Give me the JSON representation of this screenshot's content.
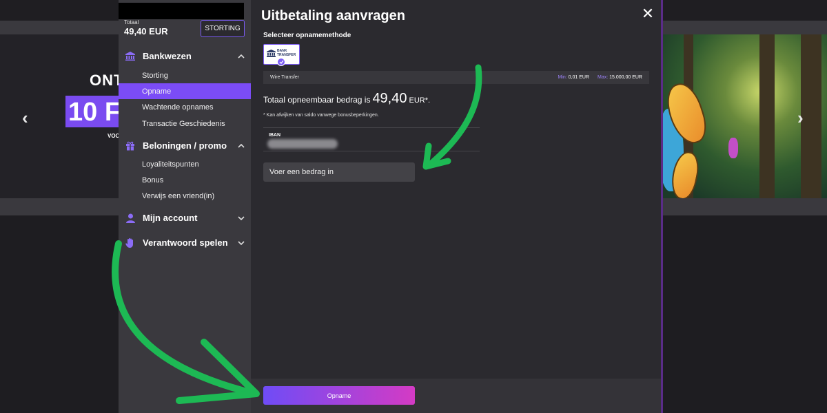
{
  "background": {
    "hero_title": "ONT",
    "hero_badge": "10 F",
    "hero_sub": "VOO",
    "prev_arrow": "‹",
    "next_arrow": "›"
  },
  "sidebar": {
    "total_label": "Totaal",
    "total_value": "49,40 EUR",
    "deposit_button": "STORTING",
    "sections": [
      {
        "label": "Bankwezen",
        "icon": "bank-icon",
        "chevron": "chevron-up-icon",
        "items": [
          "Storting",
          "Opname",
          "Wachtende opnames",
          "Transactie Geschiedenis"
        ],
        "active_item": "Opname"
      },
      {
        "label": "Beloningen / promo",
        "icon": "gift-icon",
        "chevron": "chevron-up-icon",
        "items": [
          "Loyaliteitspunten",
          "Bonus",
          "Verwijs een vriend(in)"
        ]
      },
      {
        "label": "Mijn account",
        "icon": "user-icon",
        "chevron": "chevron-down-icon"
      },
      {
        "label": "Verantwoord spelen",
        "icon": "hand-icon",
        "chevron": "chevron-down-icon"
      }
    ]
  },
  "modal": {
    "title": "Uitbetaling aanvragen",
    "close": "✕",
    "method_label": "Selecteer opnamemethode",
    "bank_card_text": "BANK TRANSFER",
    "method_name": "Wire Transfer",
    "min_label": "Min:",
    "min_value": "0,01 EUR",
    "max_label": "Max:",
    "max_value": "15.000,00 EUR",
    "total_prefix": "Totaal opneembaar bedrag is",
    "total_amount": "49,40",
    "total_suffix": "EUR*.",
    "note": "* Kan afwijken van saldo vanwege bonusbeperkingen.",
    "iban_label": "IBAN",
    "amount_placeholder": "Voer een bedrag in",
    "submit_button": "Opname"
  },
  "colors": {
    "accent": "#7b4cf6",
    "annotation_arrow": "#1db954",
    "button_gradient_start": "#6f4cf6",
    "button_gradient_end": "#d43bc4"
  }
}
